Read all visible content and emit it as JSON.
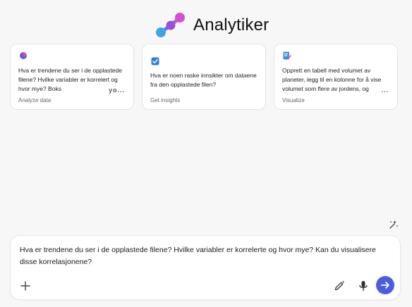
{
  "app": {
    "title": "Analytiker"
  },
  "cards": [
    {
      "icon": "pie-chart-icon",
      "text": "Hva er trendene du ser i de opplastede filene? Hvilke variabler er korrelert og hvor mye? Boks",
      "more": "yo...",
      "tag": "Analyze data"
    },
    {
      "icon": "checkbox-icon",
      "text": "Hva er noen raske innsikter om dataene fra den opplastede filen?",
      "more": "",
      "tag": "Get insights"
    },
    {
      "icon": "edit-document-icon",
      "text": "Opprett en tabell med volumet av planeter, legg til en kolonne for å vise volumet som flere av jordens, og",
      "more": "...",
      "tag": "Visualize"
    }
  ],
  "composer": {
    "prompt": "Hva er trendene du ser i de opplastede filene? Hvilke variabler er korrelerte og hvor mye? Kan du visualisere disse korrelasjonene?"
  },
  "colors": {
    "accent": "#4a5fe0",
    "logo_pink": "#d64fd0",
    "logo_purple": "#9a4fd6",
    "logo_blue": "#3aa6e8"
  }
}
